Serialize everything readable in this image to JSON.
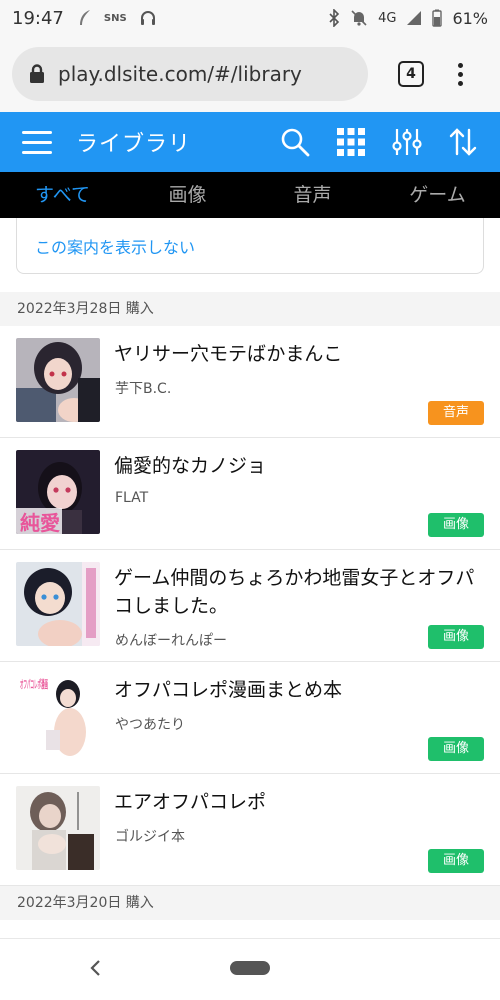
{
  "status_bar": {
    "time": "19:47",
    "left_icons": [
      "feather-icon",
      "sns-icon",
      "headphones-icon"
    ],
    "sns_text": "SNS",
    "network": "4G",
    "battery": "61%"
  },
  "browser": {
    "url": "play.dlsite.com/#/library",
    "tab_count": "4"
  },
  "app_header": {
    "title": "ライブラリ",
    "color": "#2196f3"
  },
  "tabs": [
    {
      "label": "すべて",
      "active": true
    },
    {
      "label": "画像",
      "active": false
    },
    {
      "label": "音声",
      "active": false
    },
    {
      "label": "ゲーム",
      "active": false
    }
  ],
  "notice": {
    "partial_text": "ーーーーーーーーーーーーーーーー",
    "hide_link": "この案内を表示しない"
  },
  "sections": [
    {
      "date": "2022年3月28日 購入",
      "items": [
        {
          "title": "ヤリサー穴モテばかまんこ",
          "author": "芋下B.C.",
          "badge": "音声"
        },
        {
          "title": "偏愛的なカノジョ",
          "author": "FLAT",
          "badge": "画像",
          "thumb_text": "純愛"
        },
        {
          "title": "ゲーム仲間のちょろかわ地雷女子とオフパコしました。",
          "author": "めんぼーれんぽー",
          "badge": "画像"
        },
        {
          "title": "オフパコレポ漫画まとめ本",
          "author": "やつあたり",
          "badge": "画像",
          "thumb_text": "オフパコレポ漫画"
        },
        {
          "title": "エアオフパコレポ",
          "author": "ゴルジイ本",
          "badge": "画像"
        }
      ]
    },
    {
      "date": "2022年3月20日 購入",
      "items": []
    }
  ]
}
